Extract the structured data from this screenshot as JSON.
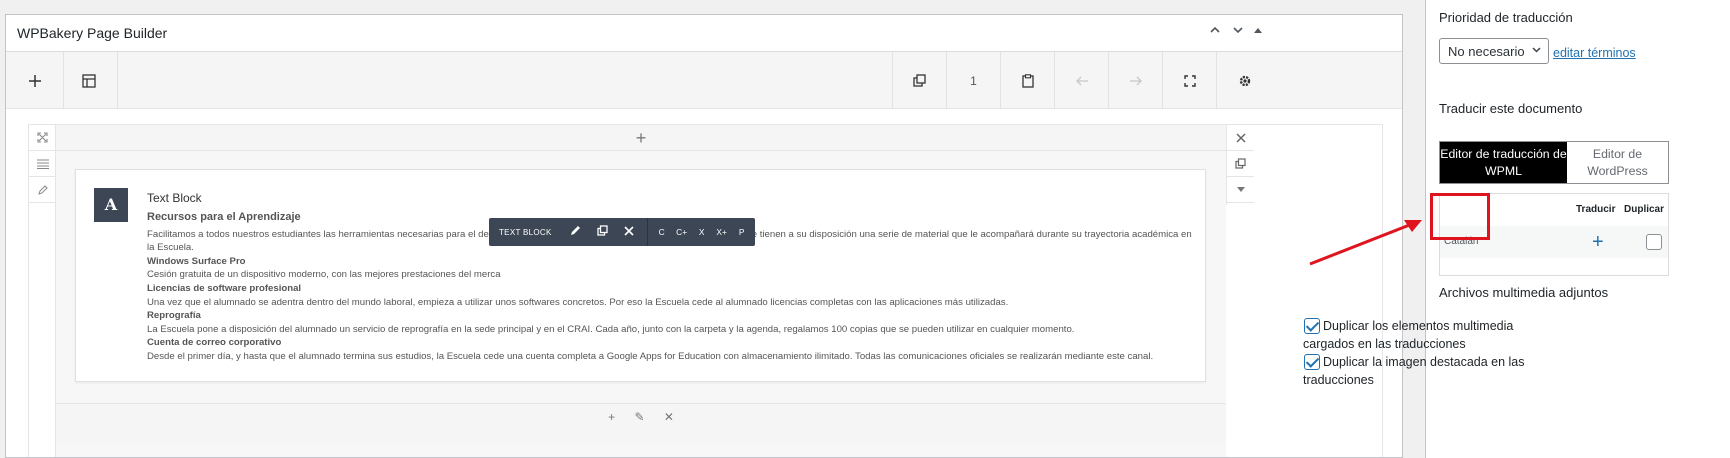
{
  "builder": {
    "title": "WPBakery Page Builder",
    "head_controls": [
      "chevron-up",
      "chevron-down",
      "triangle-up"
    ],
    "toolbar": {
      "page_count": "1"
    },
    "column_add": "+",
    "element": {
      "name": "Text Block",
      "icon_letter": "A",
      "title": "Recursos para el Aprendizaje",
      "paragraphs": [
        {
          "type": "p",
          "text": "Facilitamos a todos nuestros estudiantes las herramientas necesarias para el desarrollo de la enseñanza. Por ello, desde el primer día de clase tienen a su disposición una serie de material que le acompañará durante su trayectoria académica en la Escuela."
        },
        {
          "type": "h",
          "text": "Windows Surface Pro"
        },
        {
          "type": "p",
          "text": "Cesión gratuita de un dispositivo moderno, con las mejores prestaciones del merca"
        },
        {
          "type": "h",
          "text": "Licencias de software profesional"
        },
        {
          "type": "p",
          "text": "Una vez que el alumnado se adentra dentro del mundo laboral, empieza a utilizar unos  softwares  concretos. Por eso la Escuela cede al alumnado licencias completas con las aplicaciones más utilizadas."
        },
        {
          "type": "h",
          "text": "Reprografía"
        },
        {
          "type": "p",
          "text": "La Escuela pone a disposición del alumnado un servicio de reprografía en la sede principal y en el CRAI. Cada año, junto con la carpeta y la agenda, regalamos 100 copias que se pueden utilizar en cualquier momento."
        },
        {
          "type": "h",
          "text": "Cuenta de correo corporativo"
        },
        {
          "type": "p",
          "text": "Desde el primer día, y hasta que el alumnado termina sus estudios, la Escuela cede una cuenta completa a Google Apps for Education con almacenamiento ilimitado. Todas las comunicaciones oficiales se realizarán mediante este canal."
        }
      ]
    },
    "floatbar": {
      "label": "TEXT BLOCK",
      "small_buttons": [
        "C",
        "C+",
        "X",
        "X+",
        "P"
      ]
    }
  },
  "sidebar": {
    "priority_heading": "Prioridad de traducción",
    "priority_value": "No necesario",
    "edit_terms": "editar términos",
    "translate_heading": "Traducir este documento",
    "tab_wpml": "Editor de traducción de WPML",
    "tab_wp": "Editor de WordPress",
    "col_translate": "Traducir",
    "col_duplicate": "Duplicar",
    "language": "Catalán",
    "add_symbol": "+",
    "media_heading": "Archivos multimedia adjuntos",
    "media_option_1": "Duplicar los elementos multimedia cargados en las traducciones",
    "media_option_2": "Duplicar la imagen destacada en las traducciones"
  },
  "colors": {
    "link": "#2271b1",
    "highlight": "#e0141e",
    "dark_tab": "#000000",
    "floatbar": "#3c4654"
  }
}
